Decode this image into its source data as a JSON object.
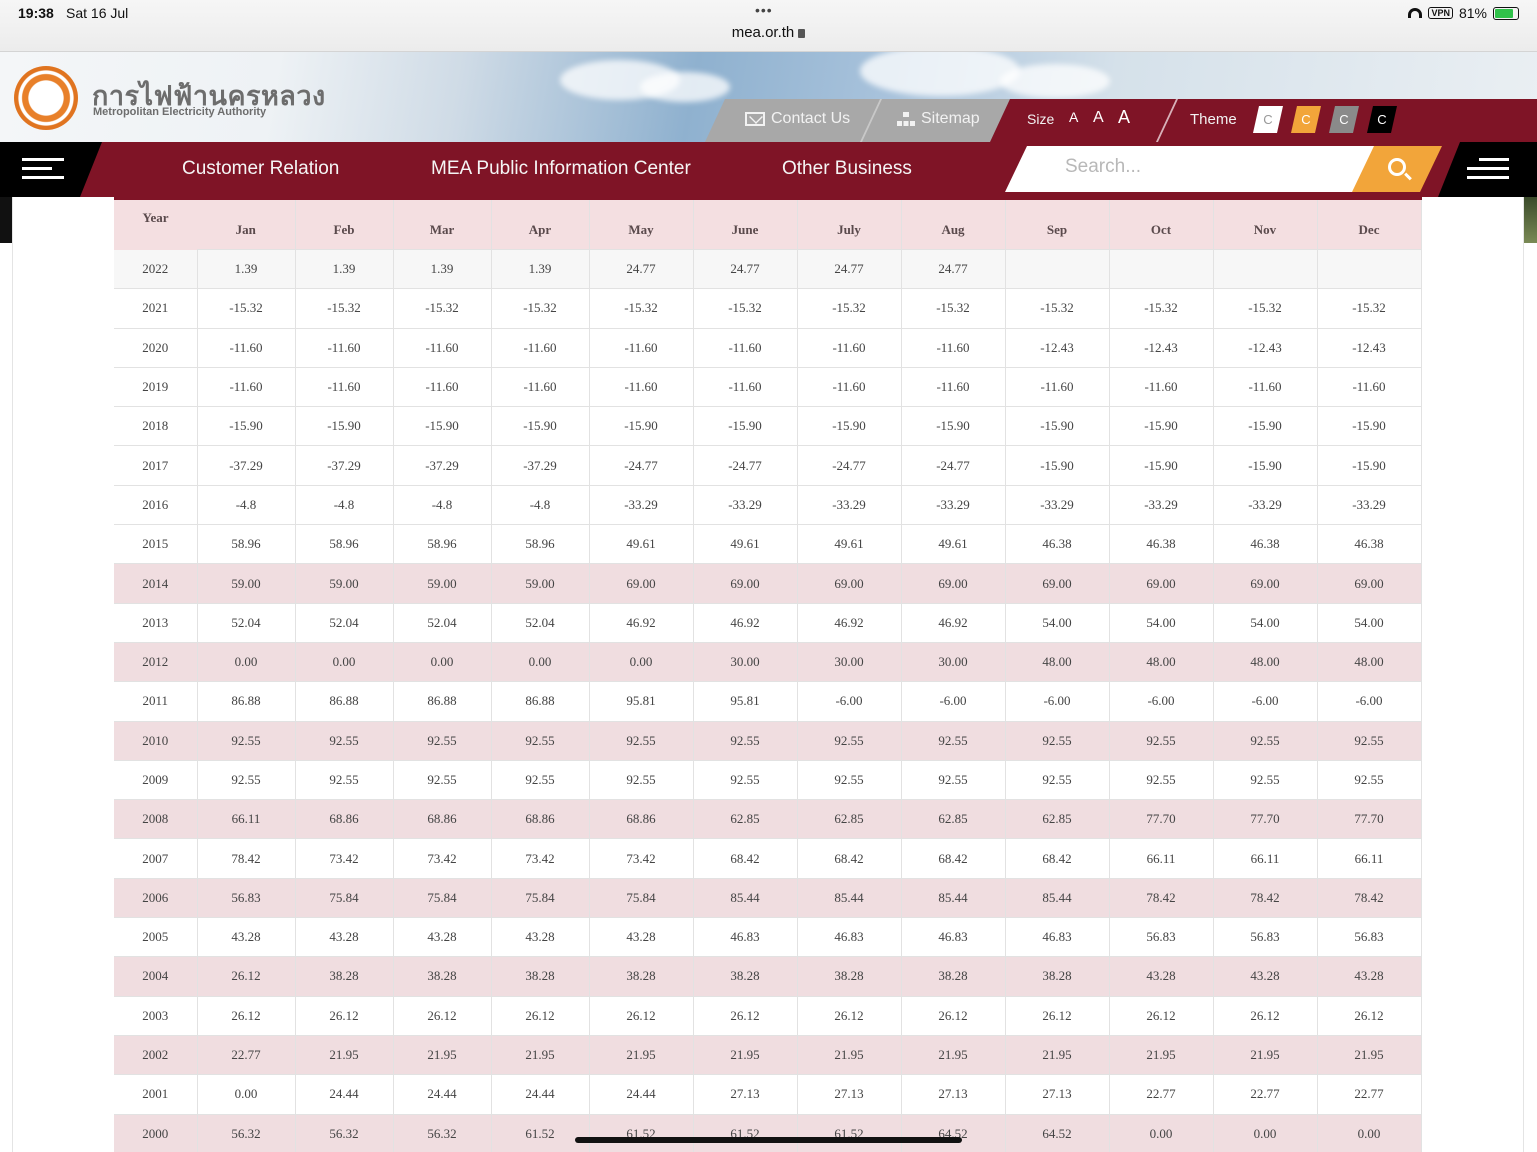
{
  "status_bar": {
    "time": "19:38",
    "date": "Sat 16 Jul",
    "dots": "•••",
    "url": "mea.or.th",
    "vpn": "VPN",
    "battery": "81%",
    "battery_level": 0.81
  },
  "brand": {
    "thai_name": "การไฟฟ้านครหลวง",
    "english_name": "Metropolitan Electricity Authority",
    "logo_icon": "mea-logo-icon"
  },
  "utility_bar": {
    "contact_us": "Contact Us",
    "sitemap": "Sitemap",
    "size_label": "Size",
    "size_options": [
      "A",
      "A",
      "A"
    ],
    "theme_label": "Theme",
    "theme_options": [
      {
        "label": "C",
        "color": "#ffffff",
        "text": "#999999"
      },
      {
        "label": "C",
        "color": "#f2a53a",
        "text": "#ffffff"
      },
      {
        "label": "C",
        "color": "#8a8a8a",
        "text": "#ffffff"
      },
      {
        "label": "C",
        "color": "#000000",
        "text": "#ffffff"
      }
    ]
  },
  "nav": {
    "items": [
      "Customer Relation",
      "MEA Public Information Center",
      "Other Business"
    ],
    "search_placeholder": "Search..."
  },
  "colors": {
    "brand_red": "#7f1426",
    "accent_orange": "#f2a53a"
  },
  "table": {
    "year_header": "Year",
    "months": [
      "Jan",
      "Feb",
      "Mar",
      "Apr",
      "May",
      "June",
      "July",
      "Aug",
      "Sep",
      "Oct",
      "Nov",
      "Dec"
    ],
    "rows": [
      {
        "year": "2022",
        "values": [
          "1.39",
          "1.39",
          "1.39",
          "1.39",
          "24.77",
          "24.77",
          "24.77",
          "24.77",
          "",
          "",
          "",
          ""
        ]
      },
      {
        "year": "2021",
        "values": [
          "-15.32",
          "-15.32",
          "-15.32",
          "-15.32",
          "-15.32",
          "-15.32",
          "-15.32",
          "-15.32",
          "-15.32",
          "-15.32",
          "-15.32",
          "-15.32"
        ]
      },
      {
        "year": "2020",
        "values": [
          "-11.60",
          "-11.60",
          "-11.60",
          "-11.60",
          "-11.60",
          "-11.60",
          "-11.60",
          "-11.60",
          "-12.43",
          "-12.43",
          "-12.43",
          "-12.43"
        ]
      },
      {
        "year": "2019",
        "values": [
          "-11.60",
          "-11.60",
          "-11.60",
          "-11.60",
          "-11.60",
          "-11.60",
          "-11.60",
          "-11.60",
          "-11.60",
          "-11.60",
          "-11.60",
          "-11.60"
        ]
      },
      {
        "year": "2018",
        "values": [
          "-15.90",
          "-15.90",
          "-15.90",
          "-15.90",
          "-15.90",
          "-15.90",
          "-15.90",
          "-15.90",
          "-15.90",
          "-15.90",
          "-15.90",
          "-15.90"
        ]
      },
      {
        "year": "2017",
        "values": [
          "-37.29",
          "-37.29",
          "-37.29",
          "-37.29",
          "-24.77",
          "-24.77",
          "-24.77",
          "-24.77",
          "-15.90",
          "-15.90",
          "-15.90",
          "-15.90"
        ]
      },
      {
        "year": "2016",
        "values": [
          "-4.8",
          "-4.8",
          "-4.8",
          "-4.8",
          "-33.29",
          "-33.29",
          "-33.29",
          "-33.29",
          "-33.29",
          "-33.29",
          "-33.29",
          "-33.29"
        ]
      },
      {
        "year": "2015",
        "values": [
          "58.96",
          "58.96",
          "58.96",
          "58.96",
          "49.61",
          "49.61",
          "49.61",
          "49.61",
          "46.38",
          "46.38",
          "46.38",
          "46.38"
        ]
      },
      {
        "year": "2014",
        "values": [
          "59.00",
          "59.00",
          "59.00",
          "59.00",
          "69.00",
          "69.00",
          "69.00",
          "69.00",
          "69.00",
          "69.00",
          "69.00",
          "69.00"
        ]
      },
      {
        "year": "2013",
        "values": [
          "52.04",
          "52.04",
          "52.04",
          "52.04",
          "46.92",
          "46.92",
          "46.92",
          "46.92",
          "54.00",
          "54.00",
          "54.00",
          "54.00"
        ]
      },
      {
        "year": "2012",
        "values": [
          "0.00",
          "0.00",
          "0.00",
          "0.00",
          "0.00",
          "30.00",
          "30.00",
          "30.00",
          "48.00",
          "48.00",
          "48.00",
          "48.00"
        ]
      },
      {
        "year": "2011",
        "values": [
          "86.88",
          "86.88",
          "86.88",
          "86.88",
          "95.81",
          "95.81",
          "-6.00",
          "-6.00",
          "-6.00",
          "-6.00",
          "-6.00",
          "-6.00"
        ]
      },
      {
        "year": "2010",
        "values": [
          "92.55",
          "92.55",
          "92.55",
          "92.55",
          "92.55",
          "92.55",
          "92.55",
          "92.55",
          "92.55",
          "92.55",
          "92.55",
          "92.55"
        ]
      },
      {
        "year": "2009",
        "values": [
          "92.55",
          "92.55",
          "92.55",
          "92.55",
          "92.55",
          "92.55",
          "92.55",
          "92.55",
          "92.55",
          "92.55",
          "92.55",
          "92.55"
        ]
      },
      {
        "year": "2008",
        "values": [
          "66.11",
          "68.86",
          "68.86",
          "68.86",
          "68.86",
          "62.85",
          "62.85",
          "62.85",
          "62.85",
          "77.70",
          "77.70",
          "77.70"
        ]
      },
      {
        "year": "2007",
        "values": [
          "78.42",
          "73.42",
          "73.42",
          "73.42",
          "73.42",
          "68.42",
          "68.42",
          "68.42",
          "68.42",
          "66.11",
          "66.11",
          "66.11"
        ]
      },
      {
        "year": "2006",
        "values": [
          "56.83",
          "75.84",
          "75.84",
          "75.84",
          "75.84",
          "85.44",
          "85.44",
          "85.44",
          "85.44",
          "78.42",
          "78.42",
          "78.42"
        ]
      },
      {
        "year": "2005",
        "values": [
          "43.28",
          "43.28",
          "43.28",
          "43.28",
          "43.28",
          "46.83",
          "46.83",
          "46.83",
          "46.83",
          "56.83",
          "56.83",
          "56.83"
        ]
      },
      {
        "year": "2004",
        "values": [
          "26.12",
          "38.28",
          "38.28",
          "38.28",
          "38.28",
          "38.28",
          "38.28",
          "38.28",
          "38.28",
          "43.28",
          "43.28",
          "43.28"
        ]
      },
      {
        "year": "2003",
        "values": [
          "26.12",
          "26.12",
          "26.12",
          "26.12",
          "26.12",
          "26.12",
          "26.12",
          "26.12",
          "26.12",
          "26.12",
          "26.12",
          "26.12"
        ]
      },
      {
        "year": "2002",
        "values": [
          "22.77",
          "21.95",
          "21.95",
          "21.95",
          "21.95",
          "21.95",
          "21.95",
          "21.95",
          "21.95",
          "21.95",
          "21.95",
          "21.95"
        ]
      },
      {
        "year": "2001",
        "values": [
          "0.00",
          "24.44",
          "24.44",
          "24.44",
          "24.44",
          "27.13",
          "27.13",
          "27.13",
          "27.13",
          "22.77",
          "22.77",
          "22.77"
        ]
      },
      {
        "year": "2000",
        "values": [
          "56.32",
          "56.32",
          "56.32",
          "61.52",
          "61.52",
          "61.52",
          "61.52",
          "64.52",
          "64.52",
          "0.00",
          "0.00",
          "0.00"
        ]
      }
    ]
  }
}
